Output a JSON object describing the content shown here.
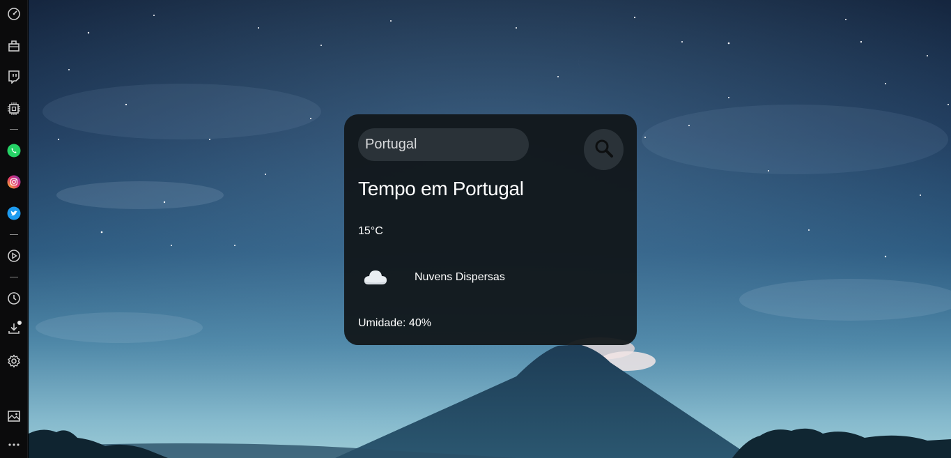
{
  "sidebar": {
    "items": [
      {
        "icon": "speedometer-icon"
      },
      {
        "icon": "bag-icon"
      },
      {
        "icon": "twitch-icon"
      },
      {
        "icon": "cpu-icon"
      },
      {
        "icon": "whatsapp-icon"
      },
      {
        "icon": "instagram-icon"
      },
      {
        "icon": "twitter-icon"
      },
      {
        "icon": "player-icon"
      },
      {
        "icon": "clock-icon"
      },
      {
        "icon": "download-icon"
      },
      {
        "icon": "gear-icon"
      },
      {
        "icon": "wallpaper-icon"
      },
      {
        "icon": "more-icon"
      }
    ]
  },
  "weather": {
    "search_value": "Portugal",
    "search_icon": "search-icon",
    "title": "Tempo em Portugal",
    "temperature": "15°C",
    "condition_icon": "cloud-icon",
    "description": "Nuvens Dispersas",
    "humidity": "Umidade: 40%"
  },
  "colors": {
    "card_bg": "#11161a",
    "input_bg": "#2a3238",
    "sidebar_bg": "#0b0b0c",
    "whatsapp": "#25d366",
    "instagram": "#e1306c",
    "twitter": "#1d9bf0"
  }
}
